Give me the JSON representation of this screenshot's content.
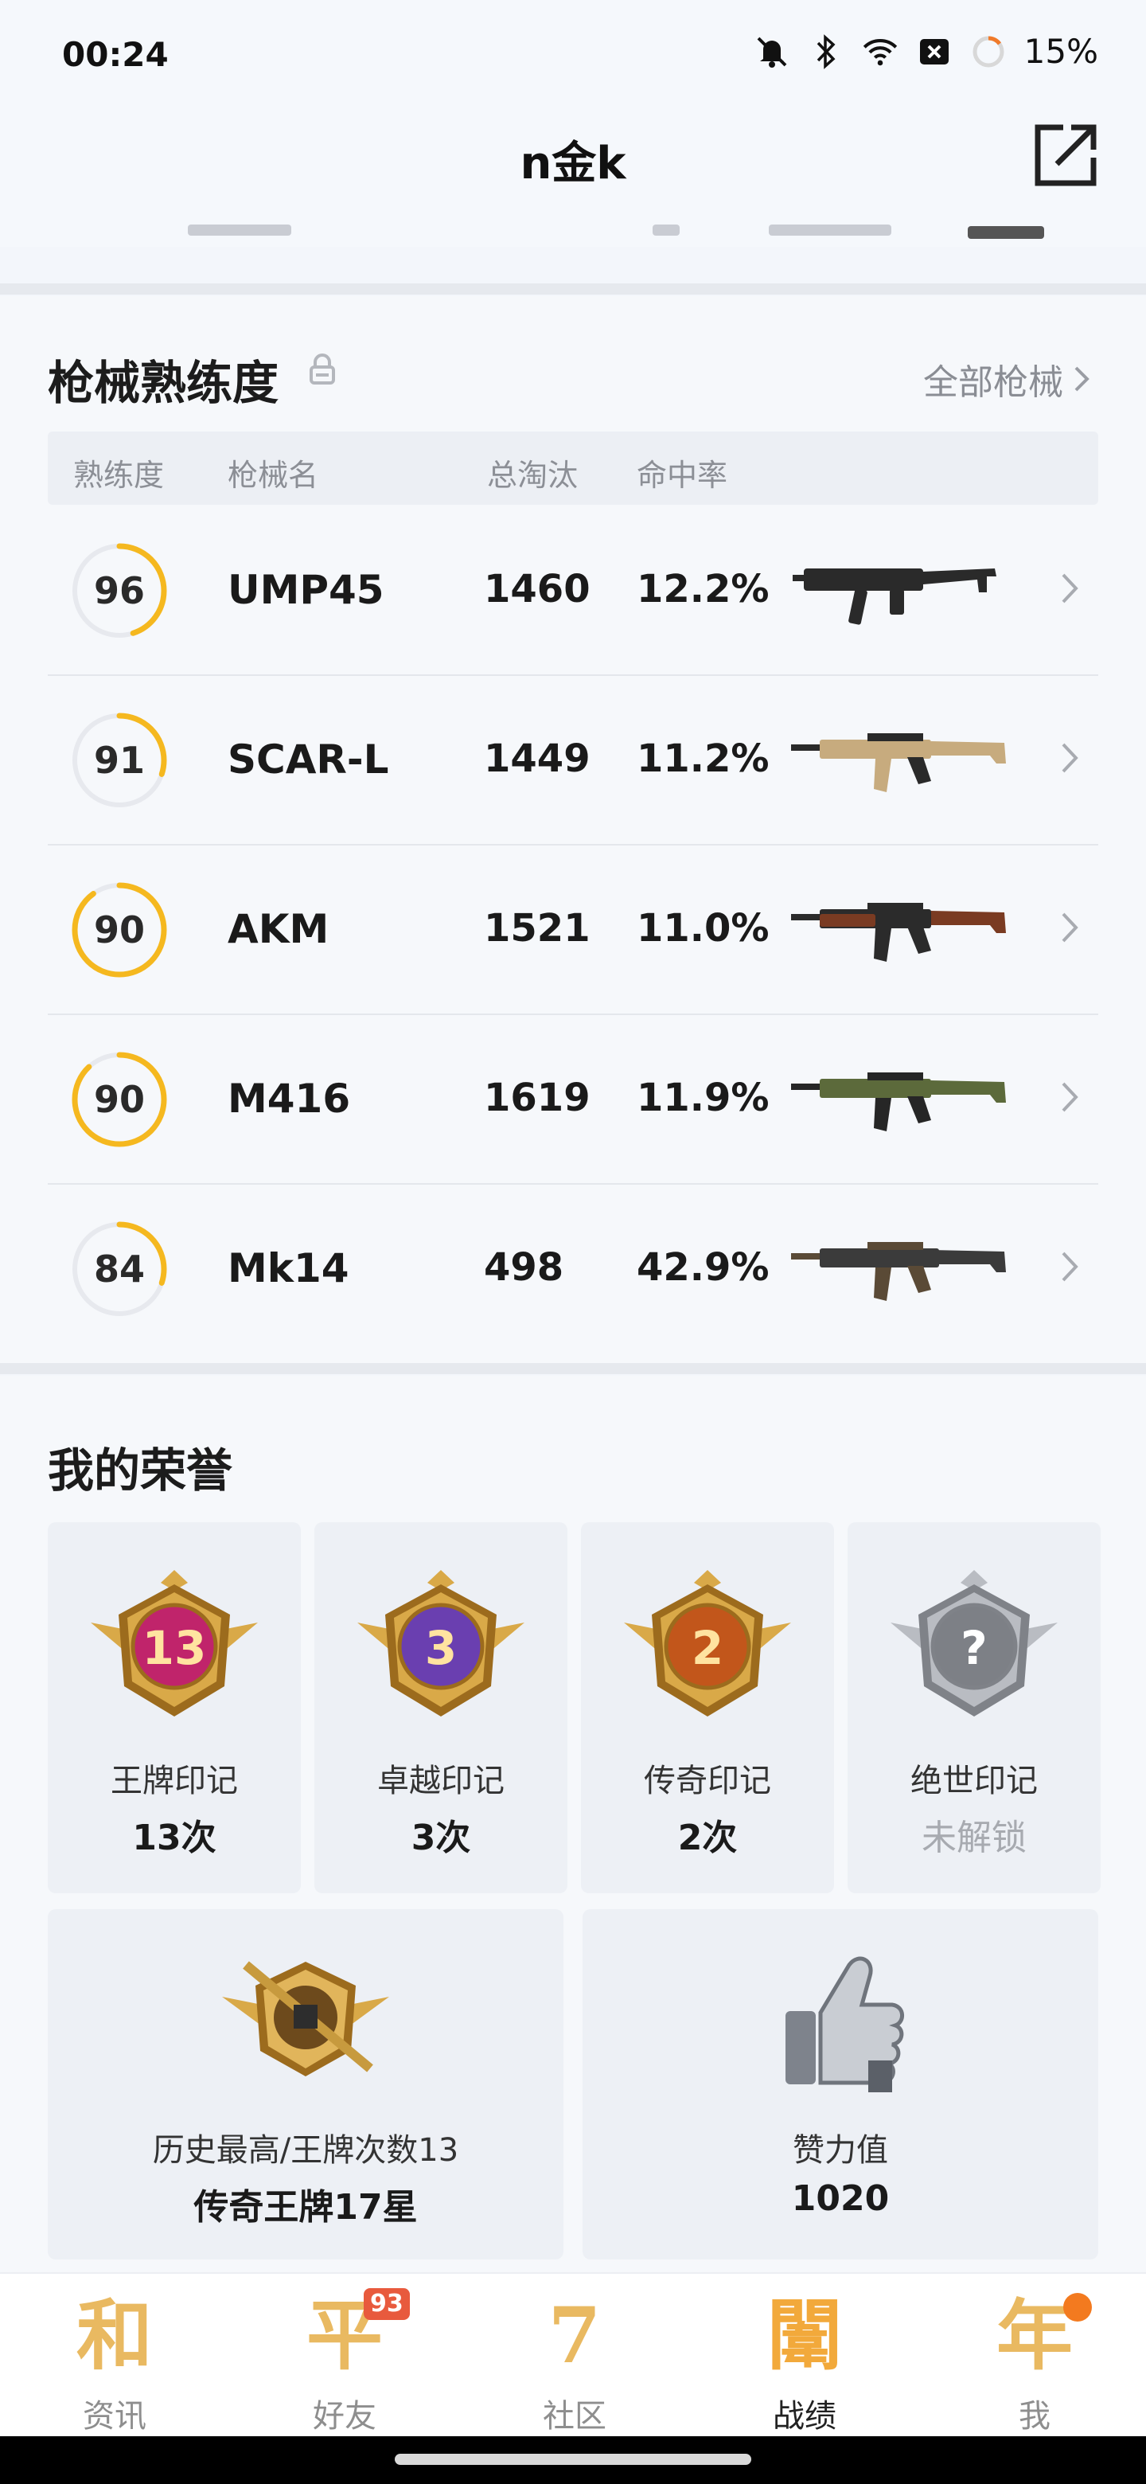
{
  "status_bar": {
    "time": "00:24",
    "battery": "15%"
  },
  "header": {
    "title": "n金k"
  },
  "weapons": {
    "title": "枪械熟练度",
    "all_link": "全部枪械",
    "columns": [
      "熟练度",
      "枪械名",
      "总淘汰",
      "命中率"
    ],
    "rows": [
      {
        "level": 96,
        "progress": 0.45,
        "name": "UMP45",
        "kills": "1460",
        "hit": "12.2%",
        "gun": "smg"
      },
      {
        "level": 91,
        "progress": 0.3,
        "name": "SCAR-L",
        "kills": "1449",
        "hit": "11.2%",
        "gun": "rifle-tan"
      },
      {
        "level": 90,
        "progress": 0.9,
        "name": "AKM",
        "kills": "1521",
        "hit": "11.0%",
        "gun": "rifle-wood"
      },
      {
        "level": 90,
        "progress": 0.88,
        "name": "M416",
        "kills": "1619",
        "hit": "11.9%",
        "gun": "rifle-green"
      },
      {
        "level": 84,
        "progress": 0.3,
        "name": "Mk14",
        "kills": "498",
        "hit": "42.9%",
        "gun": "dmr"
      }
    ]
  },
  "honors": {
    "title": "我的荣誉",
    "badges": [
      {
        "label": "王牌印记",
        "value": "13次",
        "badge_text": "13",
        "color": "#c0246b"
      },
      {
        "label": "卓越印记",
        "value": "3次",
        "badge_text": "3",
        "color": "#6a3fb0"
      },
      {
        "label": "传奇印记",
        "value": "2次",
        "badge_text": "2",
        "color": "#c2561b"
      },
      {
        "label": "绝世印记",
        "value": "未解锁",
        "badge_text": "?",
        "color": "#7d8086"
      }
    ],
    "wide": [
      {
        "label": "历史最高/王牌次数13",
        "value": "传奇王牌17星"
      },
      {
        "label": "赞力值",
        "value": "1020"
      }
    ]
  },
  "bottom_nav": [
    {
      "glyph": "和",
      "label": "资讯"
    },
    {
      "glyph": "平",
      "label": "好友",
      "badge": "93"
    },
    {
      "glyph": "7",
      "label": "社区"
    },
    {
      "glyph": "闈",
      "label": "战绩",
      "active": true
    },
    {
      "glyph": "年",
      "label": "我",
      "dot": true
    }
  ]
}
